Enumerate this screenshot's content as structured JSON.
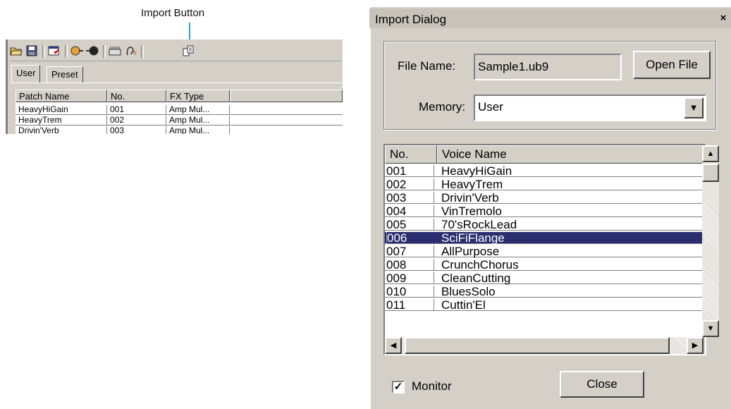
{
  "annotation": {
    "callout": "Import Button"
  },
  "main_window": {
    "toolbar_icons": [
      "open-folder-icon",
      "save-icon",
      "properties-icon",
      "send-icon",
      "receive-icon",
      "device-icon",
      "ear-icon",
      "import-icon"
    ],
    "tabs": [
      {
        "label": "User"
      },
      {
        "label": "Preset"
      }
    ],
    "columns": [
      "Patch Name",
      "No.",
      "FX Type"
    ],
    "rows": [
      {
        "name": "HeavyHiGain",
        "no": "001",
        "fx": "Amp Mul..."
      },
      {
        "name": "HeavyTrem",
        "no": "002",
        "fx": "Amp Mul..."
      },
      {
        "name": "Drivin'Verb",
        "no": "003",
        "fx": "Amp Mul..."
      }
    ]
  },
  "dialog": {
    "title": "Import Dialog",
    "close_glyph": "×",
    "file_name_label": "File Name:",
    "file_name_value": "Sample1.ub9",
    "open_file_label": "Open File",
    "memory_label": "Memory:",
    "memory_value": "User",
    "columns": {
      "no": "No.",
      "name": "Voice Name"
    },
    "voices": [
      {
        "no": "001",
        "name": "HeavyHiGain"
      },
      {
        "no": "002",
        "name": "HeavyTrem"
      },
      {
        "no": "003",
        "name": "Drivin'Verb"
      },
      {
        "no": "004",
        "name": "VinTremolo"
      },
      {
        "no": "005",
        "name": "70'sRockLead"
      },
      {
        "no": "006",
        "name": "SciFiFlange",
        "selected": true
      },
      {
        "no": "007",
        "name": "AllPurpose"
      },
      {
        "no": "008",
        "name": "CrunchChorus"
      },
      {
        "no": "009",
        "name": "CleanCutting"
      },
      {
        "no": "010",
        "name": "BluesSolo"
      },
      {
        "no": "011",
        "name": "Cuttin'El"
      }
    ],
    "monitor_label": "Monitor",
    "monitor_checked": true,
    "close_label": "Close",
    "selection_color": "#2a2d6e",
    "callout_color": "#2aa0d8"
  }
}
